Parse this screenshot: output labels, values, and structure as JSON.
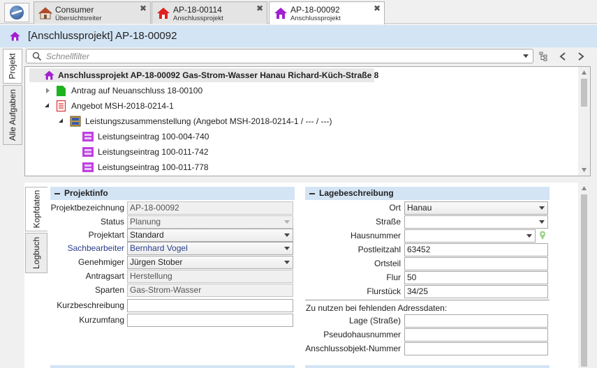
{
  "tabs": [
    {
      "title": "Consumer",
      "subtitle": "Übersichtsreiter",
      "close": "✖",
      "active": false
    },
    {
      "title": "AP-18-00114",
      "subtitle": "Anschlussprojekt",
      "close": "✖",
      "active": false
    },
    {
      "title": "AP-18-00092",
      "subtitle": "Anschlussprojekt",
      "close": "✖",
      "active": true
    }
  ],
  "header": {
    "title": "[Anschlussprojekt] AP-18-00092"
  },
  "left_tabs": [
    "Projekt",
    "Alle Aufgaben"
  ],
  "filter": {
    "placeholder": "Schnellfilter"
  },
  "tree": [
    {
      "label": "Anschlussprojekt AP-18-00092 Gas-Strom-Wasser Hanau Richard-Küch-Straße 8",
      "icon": "house-purple-icon",
      "bold": true
    },
    {
      "label": "Antrag auf Neuanschluss 18-00100",
      "icon": "green-document-icon",
      "state": "collapsed"
    },
    {
      "label": "Angebot MSH-2018-0214-1",
      "icon": "red-offer-icon",
      "state": "expanded"
    },
    {
      "label": "Leistungszusammenstellung (Angebot MSH-2018-0214-1 / --- / ---)",
      "icon": "cabinet-icon",
      "state": "expanded"
    },
    {
      "label": "Leistungseintrag 100-004-740",
      "icon": "service-entry-icon"
    },
    {
      "label": "Leistungseintrag 100-011-742",
      "icon": "service-entry-icon"
    },
    {
      "label": "Leistungseintrag 100-011-778",
      "icon": "service-entry-icon"
    }
  ],
  "side_tabs": [
    "Kopfdaten",
    "Logbuch"
  ],
  "projektinfo": {
    "header": "Projektinfo",
    "fields": [
      {
        "label": "Projektbezeichnung",
        "value": "AP-18-00092"
      },
      {
        "label": "Status",
        "value": "Planung"
      },
      {
        "label": "Projektart",
        "value": "Standard"
      },
      {
        "label": "Sachbearbeiter",
        "value": "Bernhard Vogel"
      },
      {
        "label": "Genehmiger",
        "value": "Jürgen Stober"
      },
      {
        "label": "Antragsart",
        "value": "Herstellung"
      },
      {
        "label": "Sparten",
        "value": "Gas-Strom-Wasser"
      },
      {
        "label": "Kurzbeschreibung",
        "value": ""
      },
      {
        "label": "Kurzumfang",
        "value": ""
      }
    ]
  },
  "lagebeschreibung": {
    "header": "Lagebeschreibung",
    "fields": [
      {
        "label": "Ort",
        "value": "Hanau"
      },
      {
        "label": "Straße",
        "value": ""
      },
      {
        "label": "Hausnummer",
        "value": ""
      },
      {
        "label": "Postleitzahl",
        "value": "63452"
      },
      {
        "label": "Ortsteil",
        "value": ""
      },
      {
        "label": "Flur",
        "value": "50"
      },
      {
        "label": "Flurstück",
        "value": "34/25"
      }
    ],
    "note": "Zu nutzen bei fehlenden Adressdaten:",
    "extra_fields": [
      {
        "label": "Lage (Straße)",
        "value": ""
      },
      {
        "label": "Pseudohausnummer",
        "value": ""
      },
      {
        "label": "Anschlussobjekt-Nummer",
        "value": ""
      }
    ]
  }
}
